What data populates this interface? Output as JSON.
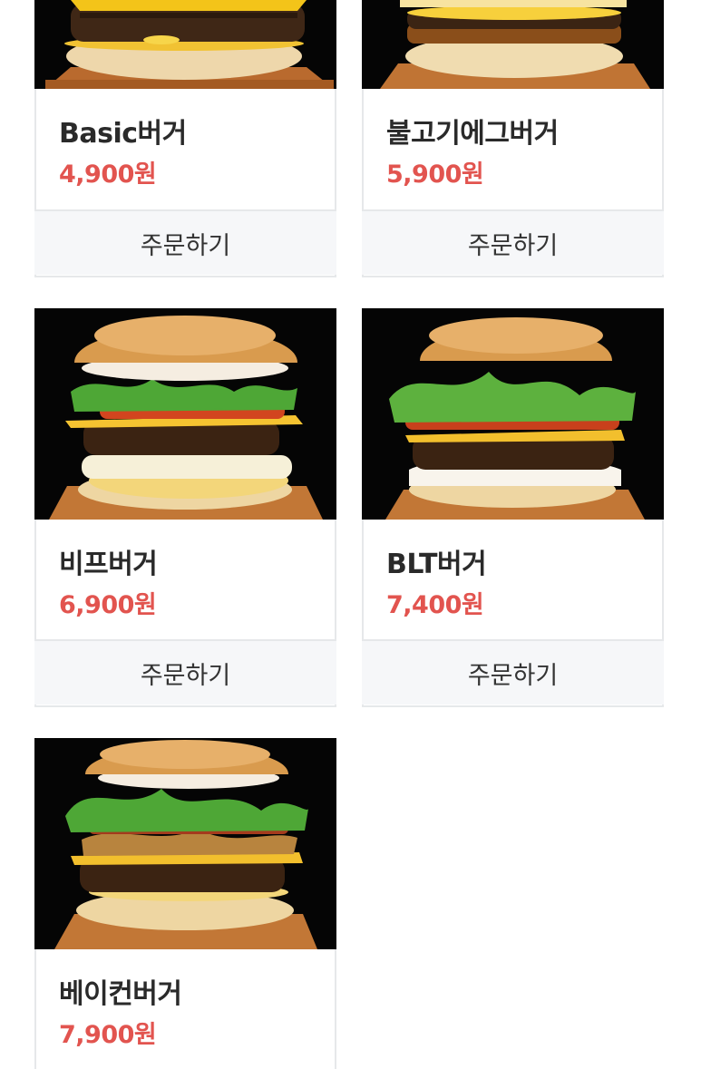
{
  "products": [
    {
      "name": "Basic버거",
      "price": "4,900원",
      "order_label": "주문하기"
    },
    {
      "name": "불고기에그버거",
      "price": "5,900원",
      "order_label": "주문하기"
    },
    {
      "name": "비프버거",
      "price": "6,900원",
      "order_label": "주문하기"
    },
    {
      "name": "BLT버거",
      "price": "7,400원",
      "order_label": "주문하기"
    },
    {
      "name": "베이컨버거",
      "price": "7,900원"
    }
  ],
  "colors": {
    "price": "#e2544f",
    "name": "#2a2a2a",
    "button_bg": "#f6f7f9",
    "border": "#e6e8ea"
  }
}
